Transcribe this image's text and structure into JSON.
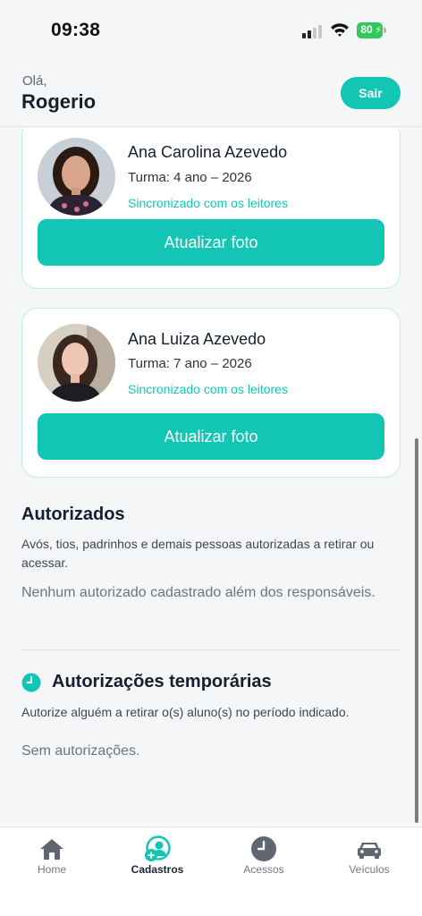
{
  "status_bar": {
    "time": "09:38",
    "battery": "80"
  },
  "header": {
    "greeting": "Olá,",
    "name": "Rogerio",
    "logout_label": "Sair"
  },
  "students": [
    {
      "name": "Ana Carolina Azevedo",
      "class": "Turma: 4 ano – 2026",
      "sync": "Sincronizado com os leitores",
      "button": "Atualizar foto"
    },
    {
      "name": "Ana Luiza Azevedo",
      "class": "Turma: 7 ano – 2026",
      "sync": "Sincronizado com os leitores",
      "button": "Atualizar foto"
    }
  ],
  "authorized": {
    "title": "Autorizados",
    "description": "Avós, tios, padrinhos e demais pessoas autorizadas a retirar ou acessar.",
    "empty": "Nenhum autorizado cadastrado além dos responsáveis."
  },
  "temporary": {
    "title": "Autorizações temporárias",
    "description": "Autorize alguém a retirar o(s) aluno(s) no período indicado.",
    "empty": "Sem autorizações."
  },
  "tab_bar": {
    "active": "Cadastros",
    "items": [
      {
        "label": "Home",
        "icon": "home-icon"
      },
      {
        "label": "Cadastros",
        "icon": "person-add-icon"
      },
      {
        "label": "Acessos",
        "icon": "clock-icon"
      },
      {
        "label": "Veículos",
        "icon": "car-icon"
      }
    ]
  },
  "colors": {
    "accent": "#12c5b5",
    "text": "#15202e",
    "muted": "#6c7580",
    "card_border": "#bfeee9"
  }
}
